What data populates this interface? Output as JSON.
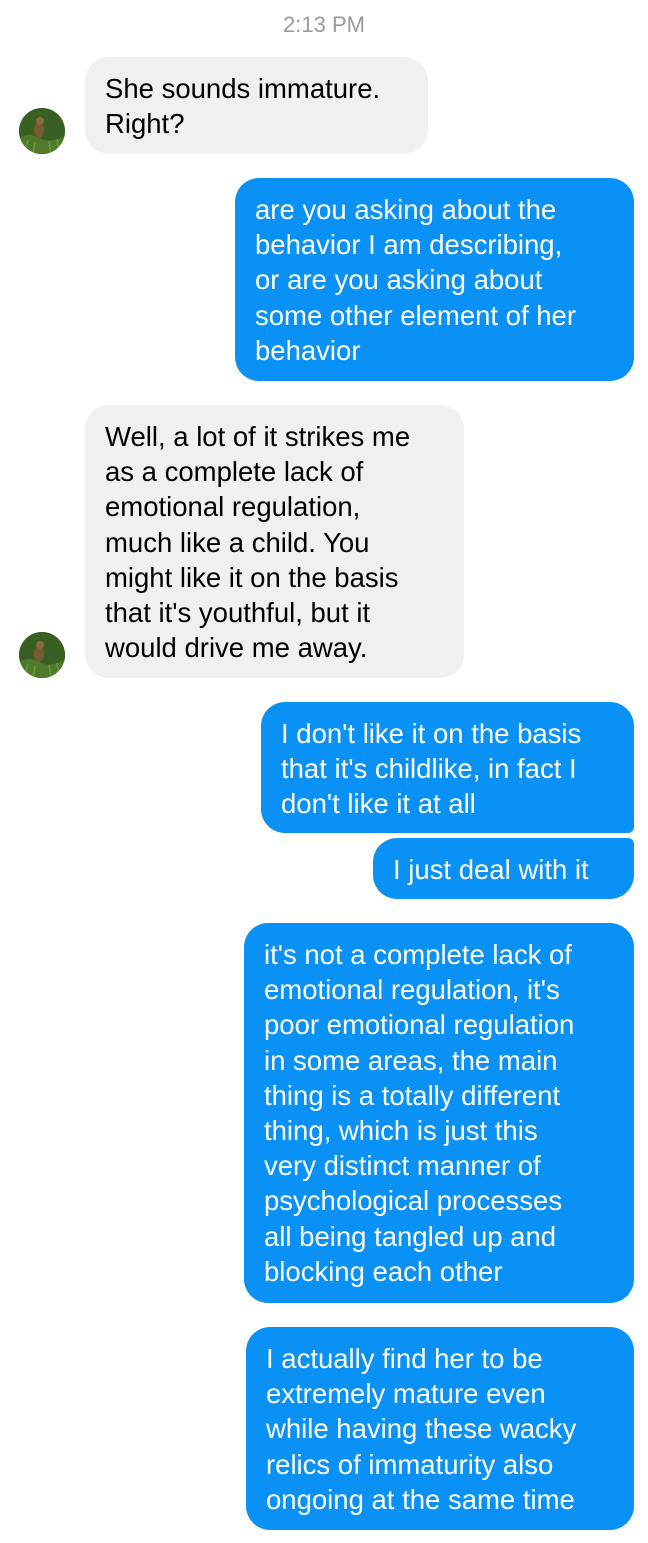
{
  "conversation": {
    "timestamp": "2:13 PM",
    "messages": [
      {
        "from": "them",
        "text": "She sounds immature.\nRight?"
      },
      {
        "from": "me",
        "text": "are you asking about the\nbehavior I am describing,\nor are you asking about\nsome other element of her\nbehavior"
      },
      {
        "from": "them",
        "text": "Well, a lot of it strikes me\nas a complete lack of\nemotional regulation,\nmuch like a child. You\nmight like it on the basis\nthat it's youthful, but it\nwould drive me away."
      },
      {
        "from": "me",
        "text": "I don't like it on the basis\nthat it's childlike, in fact I\ndon't like it at all"
      },
      {
        "from": "me",
        "text": "I just deal with it"
      },
      {
        "from": "me",
        "text": "it's not a complete lack of\nemotional regulation, it's\npoor emotional regulation\nin some areas, the main\nthing is a totally different\nthing, which is just this\nvery distinct manner of\npsychological processes\nall being tangled up and\nblocking each other"
      },
      {
        "from": "me",
        "text": "I actually find her to be\nextremely mature even\nwhile having these wacky\nrelics of immaturity also\nongoing at the same time"
      }
    ]
  },
  "colors": {
    "incoming_bubble": "#f1f0f0",
    "outgoing_bubble": "#0a91f5",
    "timestamp_text": "#9a9a9a"
  },
  "icons": {
    "contact_avatar": "avatar-photo"
  }
}
